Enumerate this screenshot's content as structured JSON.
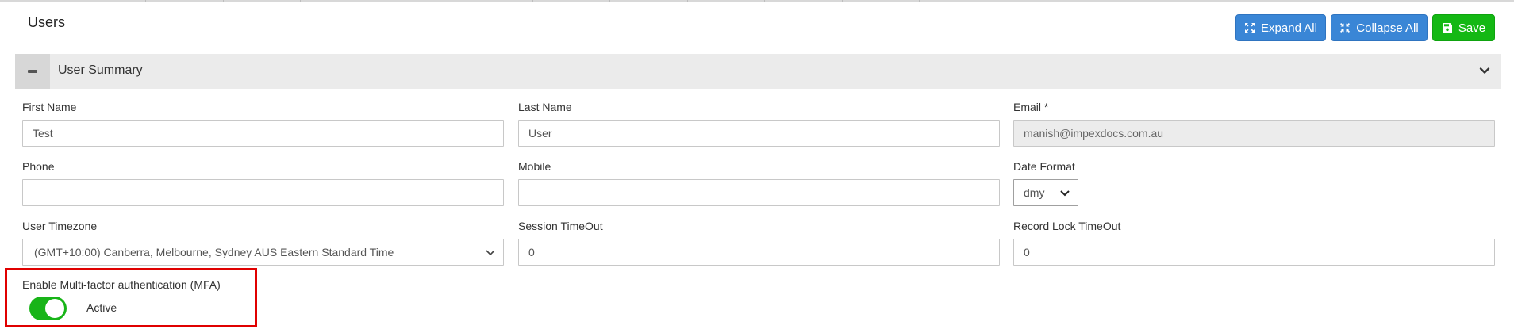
{
  "page": {
    "title": "Users"
  },
  "toolbar": {
    "expand_all": "Expand All",
    "collapse_all": "Collapse All",
    "save": "Save"
  },
  "section": {
    "title": "User Summary"
  },
  "fields": {
    "first_name": {
      "label": "First Name",
      "value": "Test"
    },
    "last_name": {
      "label": "Last Name",
      "value": "User"
    },
    "email": {
      "label": "Email *",
      "value": "manish@impexdocs.com.au"
    },
    "phone": {
      "label": "Phone",
      "value": ""
    },
    "mobile": {
      "label": "Mobile",
      "value": ""
    },
    "date_format": {
      "label": "Date Format",
      "value": "dmy"
    },
    "user_timezone": {
      "label": "User Timezone",
      "value": "(GMT+10:00) Canberra, Melbourne, Sydney AUS Eastern Standard Time"
    },
    "session_timeout": {
      "label": "Session TimeOut",
      "value": "0"
    },
    "record_lock_timeout": {
      "label": "Record Lock TimeOut",
      "value": "0"
    }
  },
  "mfa": {
    "label": "Enable Multi-factor authentication (MFA)",
    "status": "Active",
    "enabled": true
  },
  "colors": {
    "primary_button": "#3a86d6",
    "save_button": "#14b814",
    "toggle_on": "#18b418",
    "highlight_border": "#e00000",
    "section_header": "#ebebeb"
  },
  "icons": {
    "expand": "expand-arrows-icon",
    "collapse": "collapse-arrows-icon",
    "save": "floppy-disk-icon",
    "section_toggle": "minus-icon",
    "section_chevron": "chevron-down-icon",
    "select_arrow": "chevron-down-icon"
  }
}
